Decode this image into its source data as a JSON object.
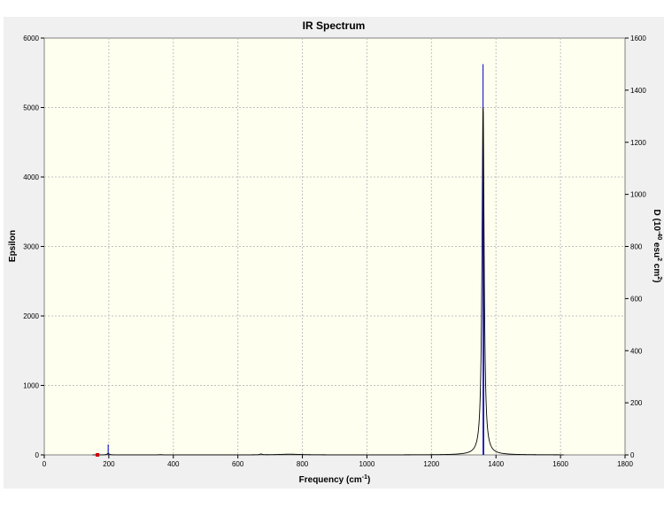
{
  "window": {
    "title": "IR Spectrum"
  },
  "chart_data": {
    "type": "line",
    "title": "IR Spectrum",
    "xlabel": "Frequency (cm",
    "xlabel_sup": "-1",
    "xlabel_end": ")",
    "ylabel": "Epsilon",
    "y2label_parts": {
      "prefix": "D (10",
      "exp1": "-40",
      "mid": " esu",
      "exp2": "2",
      "unit": " cm",
      "exp3": "2",
      "end": ")"
    },
    "xlim": [
      0,
      1800
    ],
    "ylim": [
      0,
      6000
    ],
    "y2lim": [
      0,
      1600
    ],
    "x_ticks": [
      0,
      200,
      400,
      600,
      800,
      1000,
      1200,
      1400,
      1600,
      1800
    ],
    "y_ticks": [
      0,
      1000,
      2000,
      3000,
      4000,
      5000,
      6000
    ],
    "y2_ticks": [
      0,
      200,
      400,
      600,
      800,
      1000,
      1200,
      1400,
      1600
    ],
    "grid": true,
    "spectrum": {
      "name": "Epsilon",
      "color": "#000000",
      "x_range": [
        150,
        1610
      ],
      "peaks": [
        {
          "x": 198,
          "height": 20,
          "hwhm": 4
        },
        {
          "x": 360,
          "height": 3,
          "hwhm": 8
        },
        {
          "x": 672,
          "height": 12,
          "hwhm": 4
        },
        {
          "x": 760,
          "height": 10,
          "hwhm": 40
        },
        {
          "x": 1360,
          "height": 5000,
          "hwhm": 4
        }
      ]
    },
    "sticks": {
      "name": "D",
      "color": "#0000cc",
      "x": [
        198,
        1360,
        1362
      ],
      "values": [
        40,
        1500,
        1000
      ]
    },
    "marker": {
      "x": 165,
      "y": 0,
      "color": "#cc0000"
    }
  }
}
